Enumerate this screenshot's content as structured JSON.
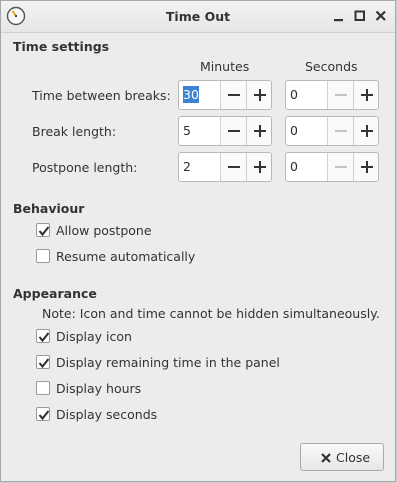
{
  "window": {
    "title": "Time Out"
  },
  "time_settings": {
    "heading": "Time settings",
    "col_minutes": "Minutes",
    "col_seconds": "Seconds",
    "rows": [
      {
        "label": "Time between breaks:",
        "minutes": "30",
        "seconds": "0"
      },
      {
        "label": "Break length:",
        "minutes": "5",
        "seconds": "0"
      },
      {
        "label": "Postpone length:",
        "minutes": "2",
        "seconds": "0"
      }
    ]
  },
  "behaviour": {
    "heading": "Behaviour",
    "options": [
      {
        "label": "Allow postpone",
        "checked": true
      },
      {
        "label": "Resume automatically",
        "checked": false
      }
    ]
  },
  "appearance": {
    "heading": "Appearance",
    "note": "Note: Icon and time cannot be hidden simultaneously.",
    "options": [
      {
        "label": "Display icon",
        "checked": true
      },
      {
        "label": "Display remaining time in the panel",
        "checked": true
      },
      {
        "label": "Display hours",
        "checked": false
      },
      {
        "label": "Display seconds",
        "checked": true
      }
    ]
  },
  "footer": {
    "close_label": "Close",
    "close_icon": "close-x-icon"
  },
  "colors": {
    "selection": "#3d84d0",
    "window_bg": "#ececec"
  }
}
